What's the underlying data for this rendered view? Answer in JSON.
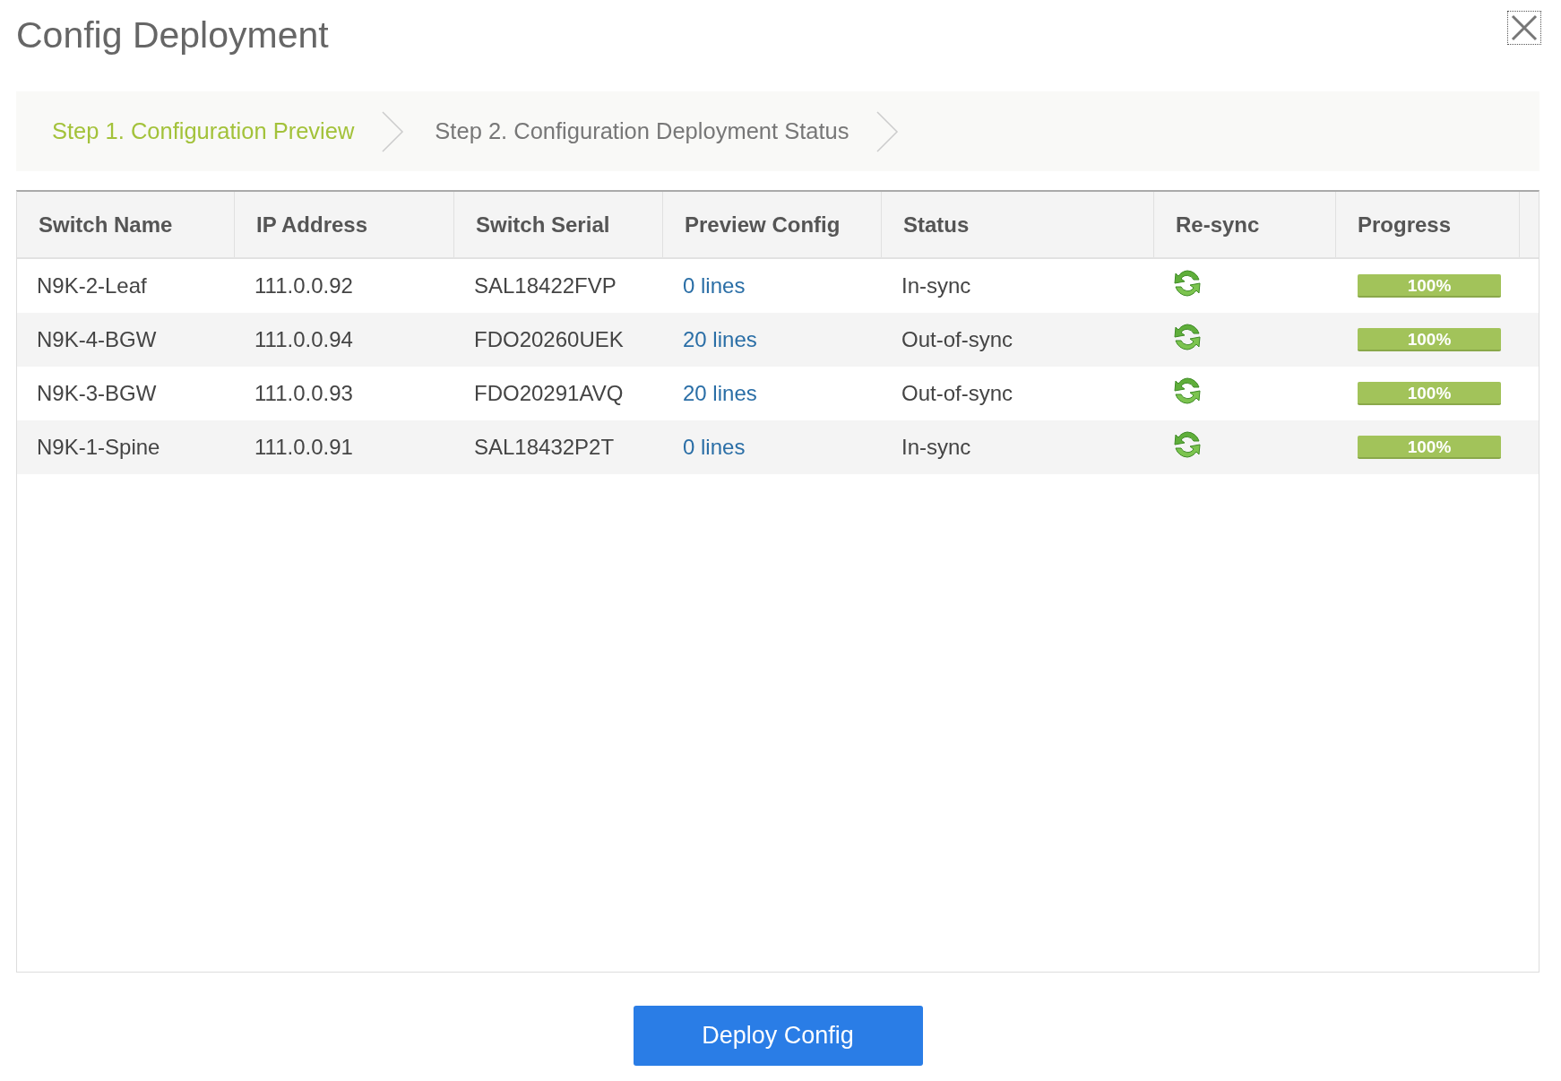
{
  "dialog": {
    "title": "Config Deployment"
  },
  "steps": [
    {
      "label": "Step 1. Configuration Preview",
      "selected": true
    },
    {
      "label": "Step 2. Configuration Deployment Status",
      "selected": false
    }
  ],
  "table": {
    "columns": [
      "Switch Name",
      "IP Address",
      "Switch Serial",
      "Preview Config",
      "Status",
      "Re-sync",
      "Progress"
    ],
    "rows": [
      {
        "switch_name": "N9K-2-Leaf",
        "ip_address": "111.0.0.92",
        "switch_serial": "SAL18422FVP",
        "preview_config": "0 lines",
        "status": "In-sync",
        "progress": {
          "level": 1,
          "label": "100%"
        }
      },
      {
        "switch_name": "N9K-4-BGW",
        "ip_address": "111.0.0.94",
        "switch_serial": "FDO20260UEK",
        "preview_config": "20 lines",
        "status": "Out-of-sync",
        "progress": {
          "level": 1,
          "label": "100%"
        }
      },
      {
        "switch_name": "N9K-3-BGW",
        "ip_address": "111.0.0.93",
        "switch_serial": "FDO20291AVQ",
        "preview_config": "20 lines",
        "status": "Out-of-sync",
        "progress": {
          "level": 1,
          "label": "100%"
        }
      },
      {
        "switch_name": "N9K-1-Spine",
        "ip_address": "111.0.0.91",
        "switch_serial": "SAL18432P2T",
        "preview_config": "0 lines",
        "status": "In-sync",
        "progress": {
          "level": 1,
          "label": "100%"
        }
      }
    ]
  },
  "buttons": [
    "Deploy Config"
  ]
}
